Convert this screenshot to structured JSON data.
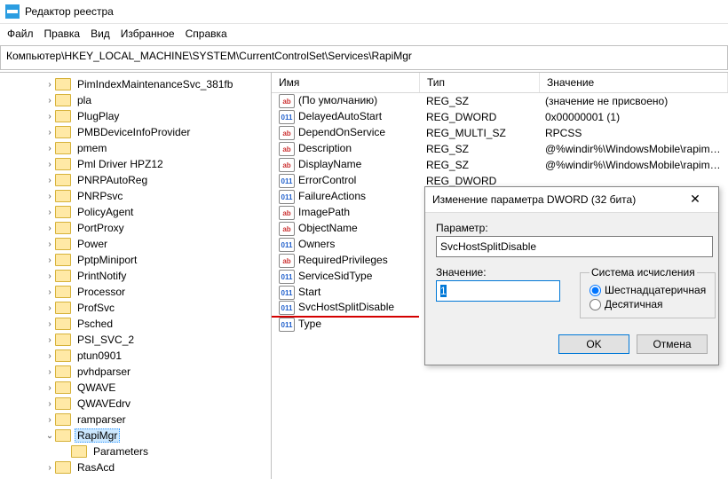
{
  "window": {
    "title": "Редактор реестра"
  },
  "menu": {
    "file": "Файл",
    "edit": "Правка",
    "view": "Вид",
    "favorites": "Избранное",
    "help": "Справка"
  },
  "address": "Компьютер\\HKEY_LOCAL_MACHINE\\SYSTEM\\CurrentControlSet\\Services\\RapiMgr",
  "tree": {
    "items": [
      {
        "indent": 40,
        "label": "PimIndexMaintenanceSvc_381fb",
        "twisty": "closed"
      },
      {
        "indent": 40,
        "label": "pla",
        "twisty": "closed"
      },
      {
        "indent": 40,
        "label": "PlugPlay",
        "twisty": "closed"
      },
      {
        "indent": 40,
        "label": "PMBDeviceInfoProvider",
        "twisty": "closed"
      },
      {
        "indent": 40,
        "label": "pmem",
        "twisty": "closed"
      },
      {
        "indent": 40,
        "label": "Pml Driver HPZ12",
        "twisty": "closed"
      },
      {
        "indent": 40,
        "label": "PNRPAutoReg",
        "twisty": "closed"
      },
      {
        "indent": 40,
        "label": "PNRPsvc",
        "twisty": "closed"
      },
      {
        "indent": 40,
        "label": "PolicyAgent",
        "twisty": "closed"
      },
      {
        "indent": 40,
        "label": "PortProxy",
        "twisty": "closed"
      },
      {
        "indent": 40,
        "label": "Power",
        "twisty": "closed"
      },
      {
        "indent": 40,
        "label": "PptpMiniport",
        "twisty": "closed"
      },
      {
        "indent": 40,
        "label": "PrintNotify",
        "twisty": "closed"
      },
      {
        "indent": 40,
        "label": "Processor",
        "twisty": "closed"
      },
      {
        "indent": 40,
        "label": "ProfSvc",
        "twisty": "closed"
      },
      {
        "indent": 40,
        "label": "Psched",
        "twisty": "closed"
      },
      {
        "indent": 40,
        "label": "PSI_SVC_2",
        "twisty": "closed"
      },
      {
        "indent": 40,
        "label": "ptun0901",
        "twisty": "closed"
      },
      {
        "indent": 40,
        "label": "pvhdparser",
        "twisty": "closed"
      },
      {
        "indent": 40,
        "label": "QWAVE",
        "twisty": "closed"
      },
      {
        "indent": 40,
        "label": "QWAVEdrv",
        "twisty": "closed"
      },
      {
        "indent": 40,
        "label": "ramparser",
        "twisty": "closed"
      },
      {
        "indent": 40,
        "label": "RapiMgr",
        "twisty": "open",
        "selected": true
      },
      {
        "indent": 58,
        "label": "Parameters",
        "twisty": "none"
      },
      {
        "indent": 40,
        "label": "RasAcd",
        "twisty": "closed"
      }
    ]
  },
  "list": {
    "headers": {
      "name": "Имя",
      "type": "Тип",
      "value": "Значение"
    },
    "rows": [
      {
        "icon": "sz",
        "name": "(По умолчанию)",
        "type": "REG_SZ",
        "value": "(значение не присвоено)"
      },
      {
        "icon": "dw",
        "name": "DelayedAutoStart",
        "type": "REG_DWORD",
        "value": "0x00000001 (1)"
      },
      {
        "icon": "sz",
        "name": "DependOnService",
        "type": "REG_MULTI_SZ",
        "value": "RPCSS"
      },
      {
        "icon": "sz",
        "name": "Description",
        "type": "REG_SZ",
        "value": "@%windir%\\WindowsMobile\\rapimgr.d"
      },
      {
        "icon": "sz",
        "name": "DisplayName",
        "type": "REG_SZ",
        "value": "@%windir%\\WindowsMobile\\rapimgr.d"
      },
      {
        "icon": "dw",
        "name": "ErrorControl",
        "type": "REG_DWORD",
        "value": ""
      },
      {
        "icon": "dw",
        "name": "FailureActions",
        "type": "",
        "value": ""
      },
      {
        "icon": "sz",
        "name": "ImagePath",
        "type": "",
        "value": ""
      },
      {
        "icon": "sz",
        "name": "ObjectName",
        "type": "",
        "value": ""
      },
      {
        "icon": "dw",
        "name": "Owners",
        "type": "",
        "value": ""
      },
      {
        "icon": "sz",
        "name": "RequiredPrivileges",
        "type": "",
        "value": ""
      },
      {
        "icon": "dw",
        "name": "ServiceSidType",
        "type": "",
        "value": ""
      },
      {
        "icon": "dw",
        "name": "Start",
        "type": "",
        "value": ""
      },
      {
        "icon": "dw",
        "name": "SvcHostSplitDisable",
        "type": "",
        "value": "",
        "underline": true
      },
      {
        "icon": "dw",
        "name": "Type",
        "type": "",
        "value": ""
      }
    ]
  },
  "dialog": {
    "title": "Изменение параметра DWORD (32 бита)",
    "param_label": "Параметр:",
    "param_value": "SvcHostSplitDisable",
    "value_label": "Значение:",
    "value_input": "1",
    "radix_label": "Система исчисления",
    "radix_hex": "Шестнадцатеричная",
    "radix_dec": "Десятичная",
    "ok": "OK",
    "cancel": "Отмена"
  }
}
